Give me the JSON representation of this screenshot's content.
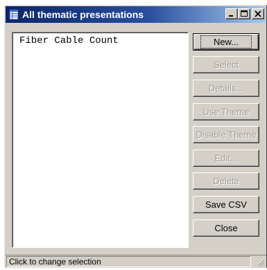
{
  "window": {
    "title": "All thematic presentations",
    "controls": {
      "minimize": "_",
      "maximize": "□",
      "close": "✕"
    }
  },
  "list": {
    "items": [
      "Fiber Cable Count"
    ]
  },
  "buttons": {
    "new": {
      "label": "New...",
      "enabled": true
    },
    "select": {
      "label": "Select",
      "enabled": false
    },
    "details": {
      "label": "Details...",
      "enabled": false
    },
    "use_theme": {
      "label": "Use Theme",
      "enabled": false
    },
    "disable_theme": {
      "label": "Disable Theme",
      "enabled": false
    },
    "edit": {
      "label": "Edit...",
      "enabled": false
    },
    "delete": {
      "label": "Delete",
      "enabled": false
    },
    "save_csv": {
      "label": "Save CSV",
      "enabled": true
    },
    "close": {
      "label": "Close",
      "enabled": true
    }
  },
  "status": {
    "text": "Click to change selection"
  },
  "icons": {
    "title_icon": "table-window-icon",
    "grip": "resize-grip-icon"
  },
  "colors": {
    "titlebar_start": "#0a246a",
    "titlebar_end": "#a6caf0",
    "face": "#d4d0c8",
    "disabled_text": "#a09c94"
  }
}
